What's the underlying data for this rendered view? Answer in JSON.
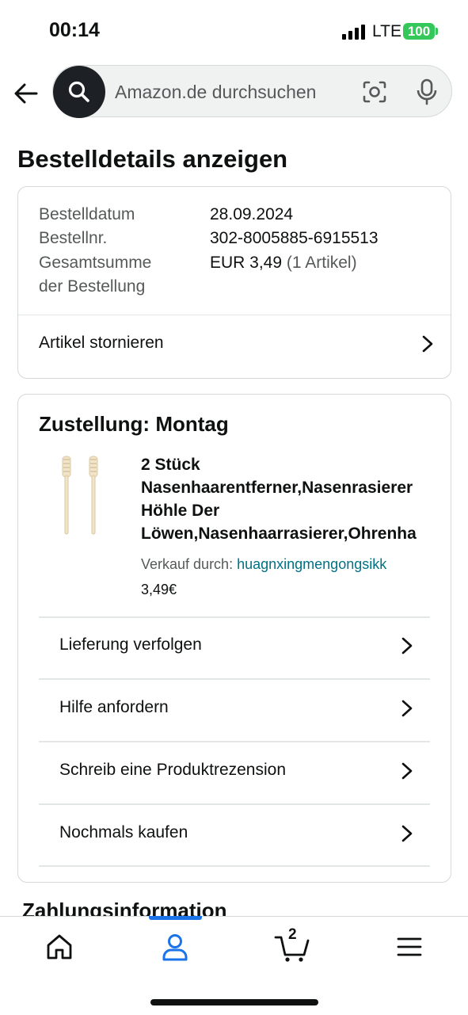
{
  "status_bar": {
    "time": "00:14",
    "network": "LTE",
    "battery": "100"
  },
  "search": {
    "placeholder": "Amazon.de durchsuchen"
  },
  "page_title": "Bestelldetails anzeigen",
  "order_summary": {
    "rows": [
      {
        "label": "Bestelldatum",
        "value": "28.09.2024"
      },
      {
        "label": "Bestellnr.",
        "value": "302-8005885-6915513"
      },
      {
        "label_line1": "Gesamtsumme",
        "label_line2": "der Bestellung",
        "value": "EUR 3,49",
        "value_suffix": "(1 Artikel)"
      }
    ],
    "cancel_label": "Artikel stornieren"
  },
  "shipment": {
    "heading": "Zustellung: Montag",
    "product": {
      "title_lines": [
        "2 Stück",
        "Nasenhaarentferner,Nasenrasierer",
        "Höhle Der",
        "Löwen,Nasenhaarrasierer,Ohrenha"
      ],
      "seller_prefix": "Verkauf durch:",
      "seller_name": "huagnxingmengongsikk",
      "price": "3,49€"
    },
    "actions": [
      {
        "label": "Lieferung verfolgen"
      },
      {
        "label": "Hilfe anfordern"
      },
      {
        "label": "Schreib eine Produktrezension"
      },
      {
        "label": "Nochmals kaufen"
      }
    ]
  },
  "payment_heading": "Zahlungsinformation",
  "tabbar": {
    "active_tab": "account",
    "cart_count": "2",
    "accent_color": "#1a73e8",
    "tabs": [
      "home-icon",
      "account-icon",
      "cart-icon",
      "menu-icon"
    ]
  }
}
